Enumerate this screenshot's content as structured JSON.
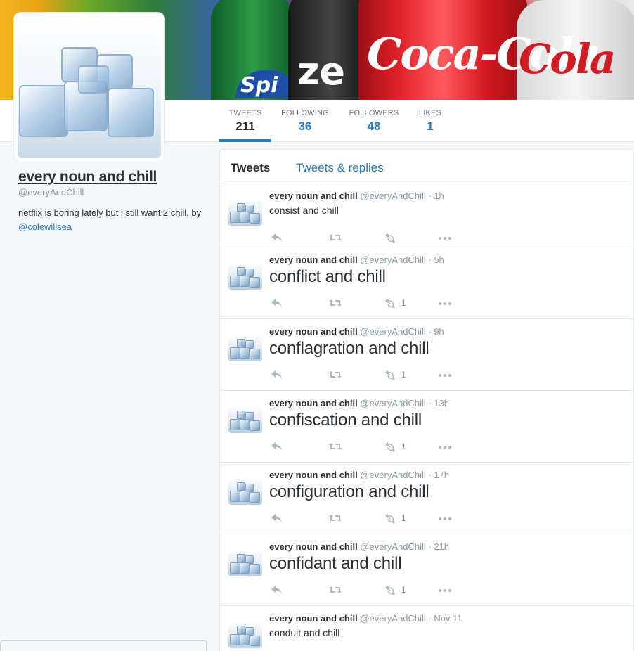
{
  "banner": {
    "brand_text": "Coca-Cola",
    "brand_text_2": "Cola",
    "zero_text": "ze",
    "sprite_text": "Spi"
  },
  "profile": {
    "name": "every noun and chill",
    "handle": "@everyAndChill",
    "bio": "netflix is boring lately but i still want 2 chill. by ",
    "bio_link": "@colewillsea"
  },
  "stats": [
    {
      "label": "TWEETS",
      "value": "211"
    },
    {
      "label": "FOLLOWING",
      "value": "36"
    },
    {
      "label": "FOLLOWERS",
      "value": "48"
    },
    {
      "label": "LIKES",
      "value": "1"
    }
  ],
  "timeline_tabs": {
    "tweets": "Tweets",
    "replies": "Tweets & replies"
  },
  "tweets": [
    {
      "name": "every noun and chill",
      "handle": "@everyAndChill",
      "sep": "·",
      "time": "1h",
      "text": "consist and chill",
      "likes": ""
    },
    {
      "name": "every noun and chill",
      "handle": "@everyAndChill",
      "sep": "·",
      "time": "5h",
      "text": "conflict and chill",
      "likes": "1"
    },
    {
      "name": "every noun and chill",
      "handle": "@everyAndChill",
      "sep": "·",
      "time": "9h",
      "text": "conflagration and chill",
      "likes": "1"
    },
    {
      "name": "every noun and chill",
      "handle": "@everyAndChill",
      "sep": "·",
      "time": "13h",
      "text": "confiscation and chill",
      "likes": "1"
    },
    {
      "name": "every noun and chill",
      "handle": "@everyAndChill",
      "sep": "·",
      "time": "17h",
      "text": "configuration and chill",
      "likes": "1"
    },
    {
      "name": "every noun and chill",
      "handle": "@everyAndChill",
      "sep": "·",
      "time": "21h",
      "text": "confidant and chill",
      "likes": "1"
    },
    {
      "name": "every noun and chill",
      "handle": "@everyAndChill",
      "sep": "·",
      "time": "Nov 11",
      "text": "conduit and chill",
      "likes": ""
    }
  ],
  "icons": {
    "reply": "reply-icon",
    "retweet": "retweet-icon",
    "like": "hammer-sickle-like-icon",
    "more": "more-dots-icon"
  },
  "colors": {
    "link": "#2b7bb9",
    "muted": "#8899a6",
    "text": "#292f33",
    "background": "#f5f8fa"
  }
}
